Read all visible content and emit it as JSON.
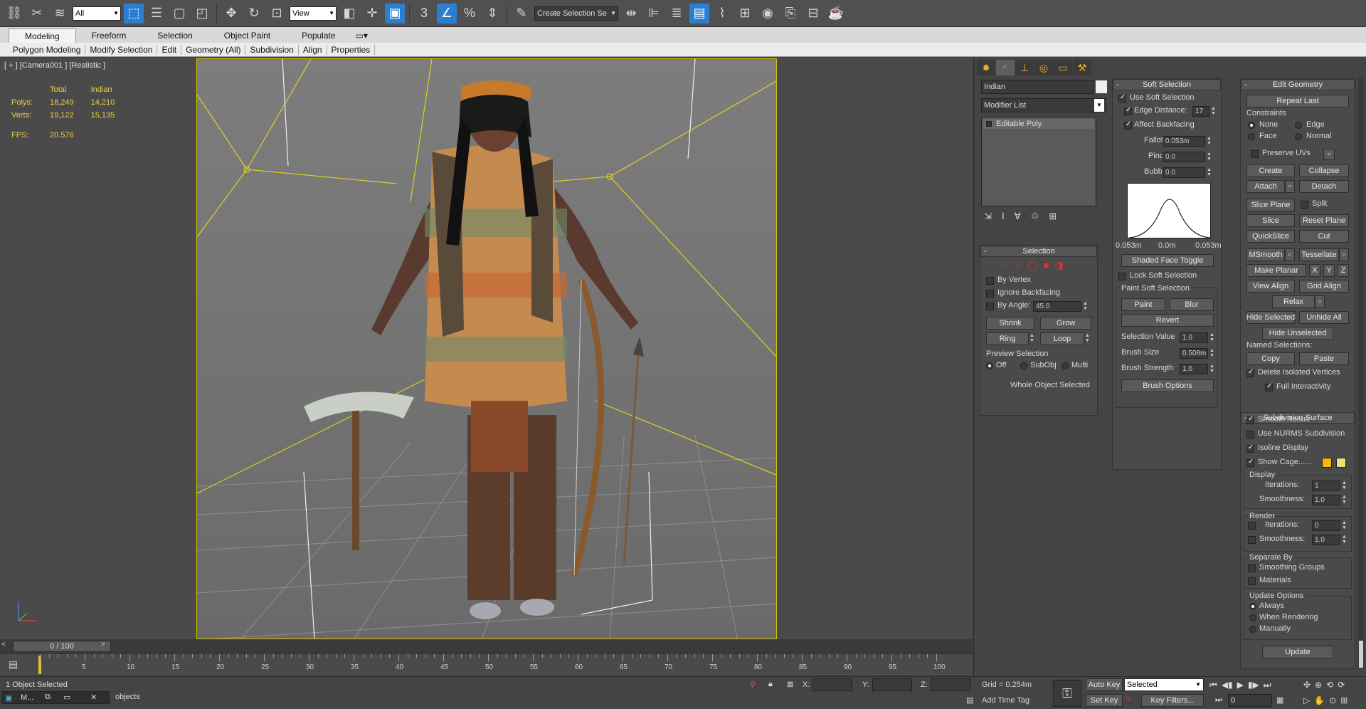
{
  "toolbar": {
    "selection_filter": "All",
    "ref_coord": "View",
    "named_selection": "Create Selection Se"
  },
  "ribbon": {
    "tabs": [
      "Modeling",
      "Freeform",
      "Selection",
      "Object Paint",
      "Populate"
    ],
    "sub_items": [
      "Polygon Modeling",
      "Modify Selection",
      "Edit",
      "Geometry (All)",
      "Subdivision",
      "Align",
      "Properties"
    ]
  },
  "viewport": {
    "label": "[ + ] [Camera001 ] [Realistic ]",
    "stats": {
      "col_total": "Total",
      "col_obj": "Indian",
      "polys_label": "Polys:",
      "polys_total": "18,249",
      "polys_obj": "14,210",
      "verts_label": "Verts:",
      "verts_total": "19,122",
      "verts_obj": "15,135",
      "fps_label": "FPS:",
      "fps_value": "20.576"
    }
  },
  "modify": {
    "object_name": "Indian",
    "modifier_list": "Modifier List",
    "stack_item": "Editable Poly",
    "selection": {
      "title": "Selection",
      "by_vertex": "By Vertex",
      "ignore_backfacing": "Ignore Backfacing",
      "by_angle": "By Angle:",
      "by_angle_value": "45.0",
      "shrink": "Shrink",
      "grow": "Grow",
      "ring": "Ring",
      "loop": "Loop",
      "preview_title": "Preview Selection",
      "off": "Off",
      "subobj": "SubObj",
      "multi": "Multi",
      "status": "Whole Object Selected"
    }
  },
  "soft_selection": {
    "title": "Soft Selection",
    "use_soft": "Use Soft Selection",
    "edge_distance": "Edge Distance:",
    "edge_distance_value": "17",
    "affect_backfacing": "Affect Backfacing",
    "falloff": "Falloff:",
    "falloff_value": "0.053m",
    "pinch": "Pinch:",
    "pinch_value": "0.0",
    "bubble": "Bubble:",
    "bubble_value": "0.0",
    "curve_left": "0.053m",
    "curve_mid": "0.0m",
    "curve_right": "0.053m",
    "shaded_face_toggle": "Shaded Face Toggle",
    "lock_soft": "Lock Soft Selection",
    "paint_title": "Paint Soft Selection",
    "paint": "Paint",
    "blur": "Blur",
    "revert": "Revert",
    "selection_value": "Selection Value",
    "selection_value_v": "1.0",
    "brush_size": "Brush Size",
    "brush_size_v": "0.508m",
    "brush_strength": "Brush Strength",
    "brush_strength_v": "1.0",
    "brush_options": "Brush Options"
  },
  "edit_geometry": {
    "title": "Edit Geometry",
    "repeat_last": "Repeat Last",
    "constraints": "Constraints",
    "none": "None",
    "edge": "Edge",
    "face": "Face",
    "normal": "Normal",
    "preserve_uvs": "Preserve UVs",
    "create": "Create",
    "collapse": "Collapse",
    "attach": "Attach",
    "detach": "Detach",
    "slice_plane": "Slice Plane",
    "split": "Split",
    "slice": "Slice",
    "reset_plane": "Reset Plane",
    "quickslice": "QuickSlice",
    "cut": "Cut",
    "msmooth": "MSmooth",
    "tessellate": "Tessellate",
    "make_planar": "Make Planar",
    "x": "X",
    "y": "Y",
    "z": "Z",
    "view_align": "View Align",
    "grid_align": "Grid Align",
    "relax": "Relax",
    "hide_selected": "Hide Selected",
    "unhide_all": "Unhide All",
    "hide_unselected": "Hide Unselected",
    "named_selections": "Named Selections:",
    "copy": "Copy",
    "paste": "Paste",
    "delete_isolated": "Delete Isolated Vertices",
    "full_interactivity": "Full Interactivity"
  },
  "subdivision": {
    "title": "Subdivision Surface",
    "smooth_result": "Smooth Result",
    "use_nurms": "Use NURMS Subdivision",
    "isoline": "Isoline Display",
    "show_cage": "Show Cage......",
    "cage_color_1": "#f3b711",
    "cage_color_2": "#e8e07a",
    "display": "Display",
    "iterations": "Iterations:",
    "iterations_v": "1",
    "smoothness": "Smoothness:",
    "smoothness_v": "1.0",
    "render": "Render",
    "r_iterations": "Iterations:",
    "r_iterations_v": "0",
    "r_smoothness": "Smoothness:",
    "r_smoothness_v": "1.0",
    "separate_by": "Separate By",
    "smoothing_groups": "Smoothing Groups",
    "materials": "Materials",
    "update_options": "Update Options",
    "always": "Always",
    "when_rendering": "When Rendering",
    "manually": "Manually",
    "update": "Update"
  },
  "timeline": {
    "frame": "0 / 100",
    "ticks": [
      "5",
      "10",
      "15",
      "20",
      "25",
      "30",
      "35",
      "40",
      "45",
      "50",
      "55",
      "60",
      "65",
      "70",
      "75",
      "80",
      "85",
      "90",
      "95",
      "100"
    ]
  },
  "status": {
    "selected": "1 Object Selected",
    "prompt": "objects",
    "x_label": "X:",
    "y_label": "Y:",
    "z_label": "Z:",
    "grid": "Grid = 0.254m",
    "add_time_tag": "Add Time Tag",
    "auto_key": "Auto Key",
    "set_key": "Set Key",
    "key_mode": "Selected",
    "key_filters": "Key Filters...",
    "frame_field": "0",
    "script_tab": "M..."
  }
}
